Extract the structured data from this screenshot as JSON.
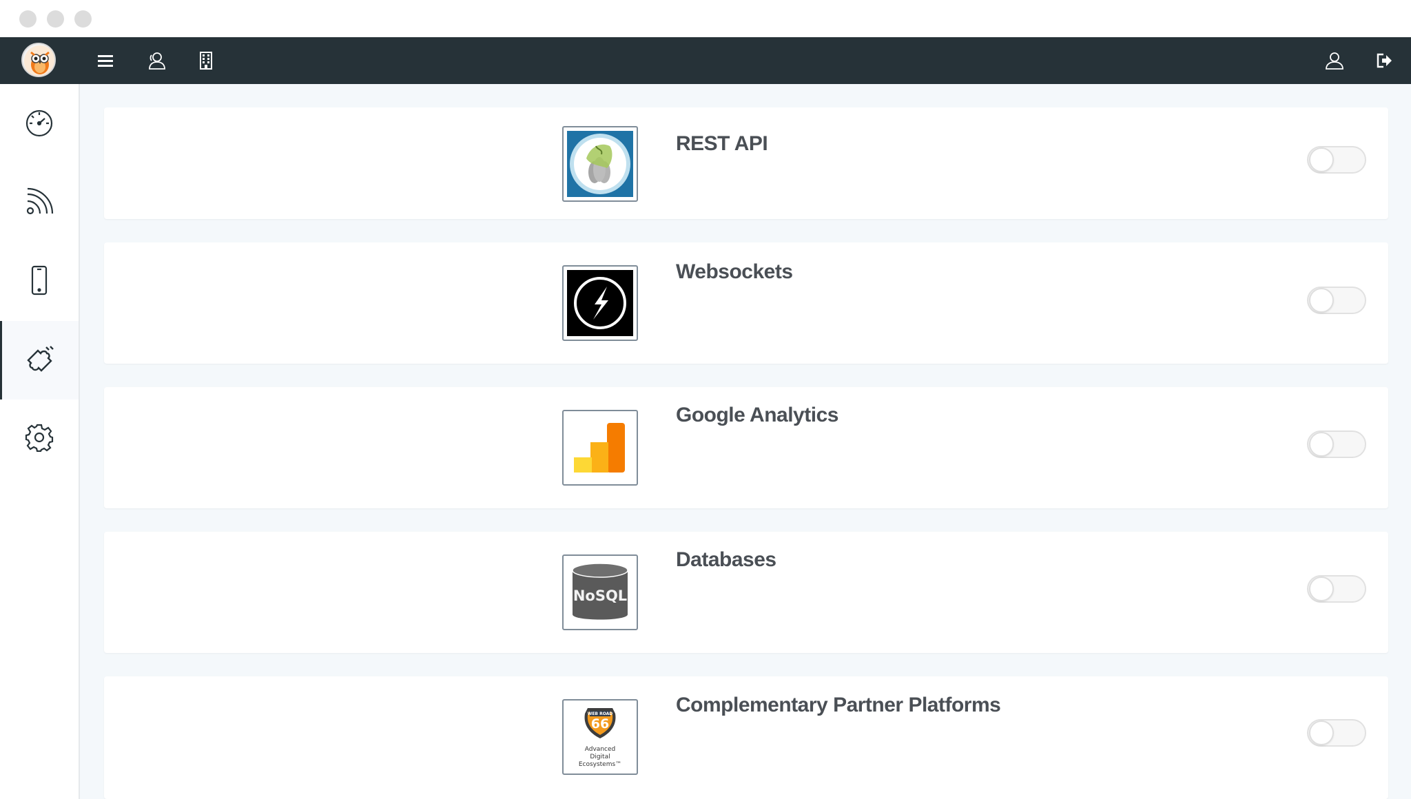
{
  "window": {
    "controls": [
      "close",
      "minimize",
      "maximize"
    ]
  },
  "topnav": {
    "logo": "owl-logo",
    "icons": [
      "menu-icon",
      "users-icon",
      "building-icon"
    ],
    "right_icons": [
      "user-icon",
      "logout-icon"
    ]
  },
  "sidebar": {
    "items": [
      {
        "icon": "dashboard-gauge-icon",
        "active": false
      },
      {
        "icon": "feed-icon",
        "active": false
      },
      {
        "icon": "mobile-icon",
        "active": false
      },
      {
        "icon": "integrations-icon",
        "active": true
      },
      {
        "icon": "settings-gear-icon",
        "active": false
      }
    ]
  },
  "integrations": [
    {
      "title": "REST API",
      "logo": "rest-api-logo",
      "enabled": false
    },
    {
      "title": "Websockets",
      "logo": "websockets-logo",
      "enabled": false
    },
    {
      "title": "Google Analytics",
      "logo": "google-analytics-logo",
      "enabled": false
    },
    {
      "title": "Databases",
      "logo": "nosql-database-logo",
      "logo_text": "NoSQL",
      "enabled": false
    },
    {
      "title": "Complementary Partner Platforms",
      "logo": "web-road-66-logo",
      "logo_text_top": "WEB ROAD",
      "logo_text_num": "66",
      "logo_text_bottom": "Advanced Digital Ecosystems™",
      "enabled": false
    }
  ],
  "colors": {
    "topnav_bg": "#263238",
    "main_bg": "#f4f8fb",
    "title_text": "#4a4f55"
  }
}
